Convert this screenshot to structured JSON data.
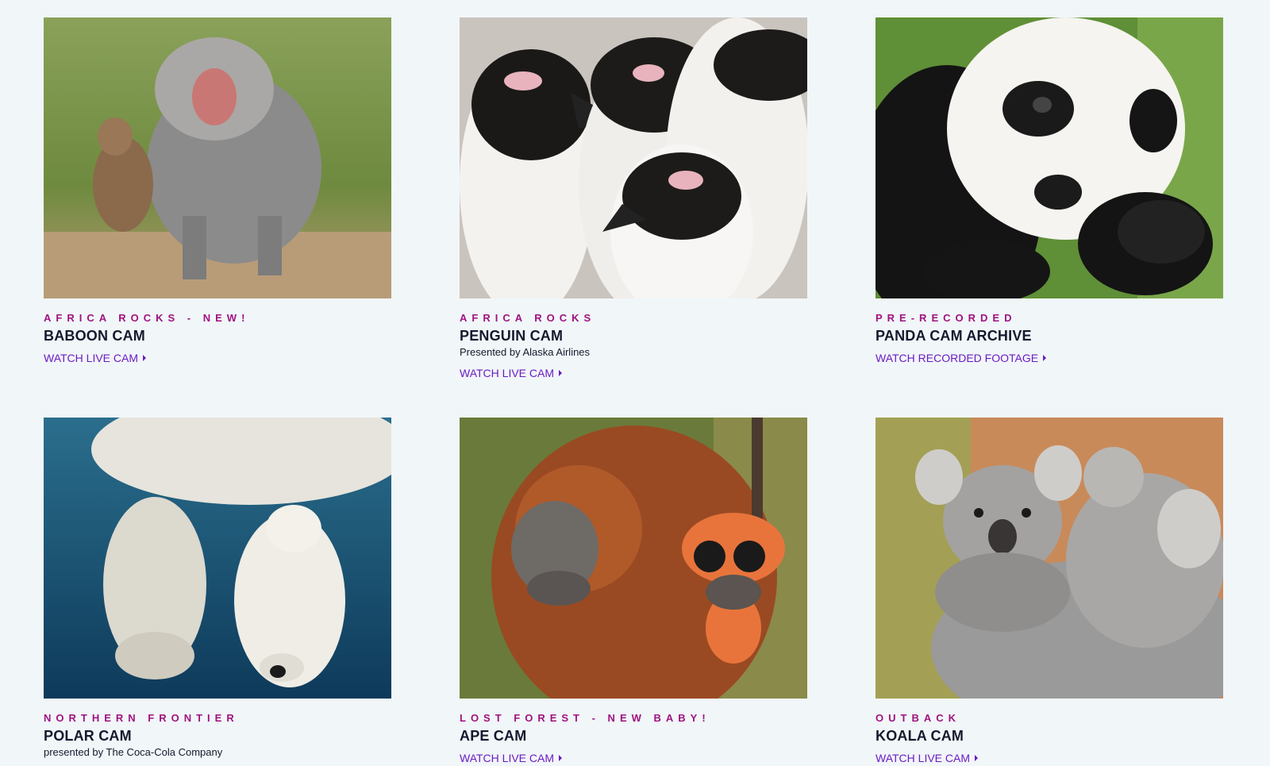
{
  "cams": [
    {
      "image_alt": "Baboons walking on a dirt path",
      "eyebrow": "AFRICA ROCKS - NEW!",
      "title": "BABOON CAM",
      "sponsor": "",
      "cta": "WATCH LIVE CAM"
    },
    {
      "image_alt": "African penguins",
      "eyebrow": "AFRICA ROCKS",
      "title": "PENGUIN CAM",
      "sponsor": "Presented by Alaska Airlines",
      "cta": "WATCH LIVE CAM"
    },
    {
      "image_alt": "Giant panda resting",
      "eyebrow": "PRE-RECORDED",
      "title": "PANDA CAM ARCHIVE",
      "sponsor": "",
      "cta": "WATCH RECORDED FOOTAGE"
    },
    {
      "image_alt": "Polar bear swimming underwater",
      "eyebrow": "NORTHERN FRONTIER",
      "title": "POLAR CAM",
      "sponsor": "presented by The Coca-Cola Company",
      "cta": ""
    },
    {
      "image_alt": "Orangutan holding an orange toy",
      "eyebrow": "LOST FOREST - NEW BABY!",
      "title": "APE CAM",
      "sponsor": "",
      "cta": "WATCH LIVE CAM"
    },
    {
      "image_alt": "Koala mother carrying joey",
      "eyebrow": "OUTBACK",
      "title": "KOALA CAM",
      "sponsor": "",
      "cta": "WATCH LIVE CAM"
    }
  ],
  "colors": {
    "background": "#f1f6f9",
    "eyebrow": "#a0117f",
    "title": "#15192e",
    "link": "#6b1cc2"
  }
}
